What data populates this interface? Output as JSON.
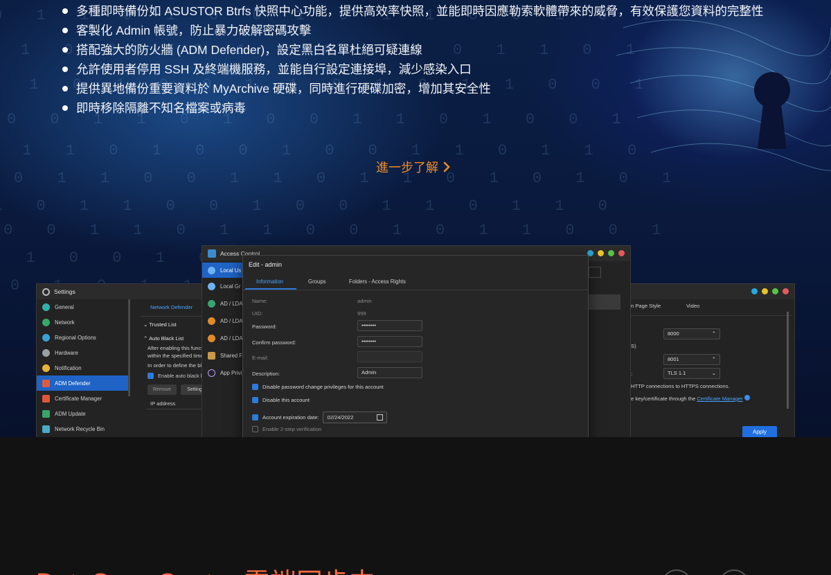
{
  "features": [
    "多種即時備份如 ASUSTOR Btrfs 快照中心功能，提供高效率快照，並能即時因應勒索軟體帶來的威脅，有效保護您資料的完整性",
    "客製化 Admin 帳號，防止暴力破解密碼攻擊",
    "搭配強大的防火牆 (ADM Defender)，設定黑白名單杜絕可疑連線",
    "允許使用者停用 SSH 及終端機服務，並能自行設定連接埠，減少感染入口",
    "提供異地備份重要資料於 MyArchive 硬碟，同時進行硬碟加密，增加其安全性",
    "即時移除隔離不知名檔案或病毒"
  ],
  "learn_more": "進一步了解",
  "settings_window": {
    "title": "Settings",
    "sidebar": [
      "General",
      "Network",
      "Regional Options",
      "Hardware",
      "Notification",
      "ADM Defender",
      "Certificate Manager",
      "ADM Update",
      "Network Recycle Bin"
    ],
    "active_index": 5,
    "tab": "Network Defender",
    "trusted_list": "Trusted List",
    "auto_black_list": "Auto Black List",
    "desc1": "After enabling this functi",
    "desc2": "within the specified time",
    "desc3": "In order to define the bla",
    "enable_auto": "Enable auto black lis",
    "remove_btn": "Remove",
    "settings_btn": "Setting",
    "ip_address": "IP address"
  },
  "access_window": {
    "title": "Access Control",
    "sidebar": [
      "Local Us",
      "Local Gr",
      "AD / LDA",
      "AD / LDA",
      "AD / LDA",
      "Shared F",
      "App Privi"
    ]
  },
  "edit_dialog": {
    "title": "Edit - admin",
    "tabs": [
      "Information",
      "Groups",
      "Folders - Access Rights"
    ],
    "name_label": "Name:",
    "name_value": "admin",
    "uid_label": "UID:",
    "uid_value": "999",
    "password_label": "Password:",
    "password_value": "••••••••",
    "confirm_label": "Confirm password:",
    "confirm_value": "••••••••",
    "email_label": "E-mail:",
    "desc_label": "Description:",
    "desc_value": "Admin",
    "disable_pw_change": "Disable password change privileges for this account",
    "disable_account": "Disable this account",
    "expiration_label": "Account expiration date:",
    "expiration_value": "02/24/2022",
    "two_step": "Enable 2-step verification"
  },
  "right_window": {
    "tab1": "n Page Style",
    "tab2": "Video",
    "port1": "8000",
    "port2": "8001",
    "tls": "TLS 1.1",
    "s_label": "S)",
    "colon": ":",
    "https_text": "HTTP connections to HTTPS connections.",
    "cert_text": "e key/certificate through the",
    "cert_link": "Certificate Manager",
    "apply": "Apply"
  },
  "footer_title": "DataSync Center 雲端同步中",
  "colors": {
    "accent": "#f08a24",
    "footer_title": "#ff6a3d",
    "apply": "#1f6fe0"
  }
}
